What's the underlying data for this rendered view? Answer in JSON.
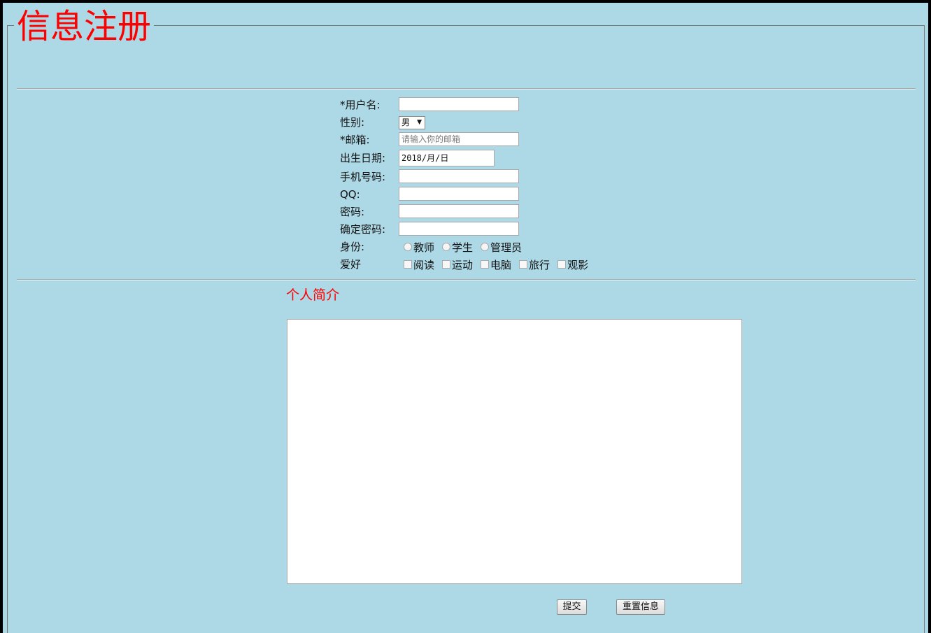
{
  "form": {
    "title": "信息注册",
    "fields": {
      "username": {
        "label": "*用户名:",
        "value": ""
      },
      "gender": {
        "label": "性别:",
        "selected": "男"
      },
      "email": {
        "label": "*邮箱:",
        "placeholder": "请输入你的邮箱",
        "value": ""
      },
      "birthdate": {
        "label": "出生日期:",
        "value": "2018/月/日"
      },
      "phone": {
        "label": "手机号码:",
        "value": ""
      },
      "qq": {
        "label": "QQ:",
        "value": ""
      },
      "password": {
        "label": "密码:",
        "value": ""
      },
      "confirm_password": {
        "label": "确定密码:",
        "value": ""
      }
    },
    "identity": {
      "label": "身份:",
      "options": [
        "教师",
        "学生",
        "管理员"
      ]
    },
    "hobbies": {
      "label": "爱好",
      "options": [
        "阅读",
        "运动",
        "电脑",
        "旅行",
        "观影"
      ]
    },
    "intro": {
      "title": "个人简介",
      "value": ""
    },
    "buttons": {
      "submit": "提交",
      "reset": "重置信息"
    }
  },
  "colors": {
    "background": "#add8e6",
    "accent": "#ff0000"
  }
}
